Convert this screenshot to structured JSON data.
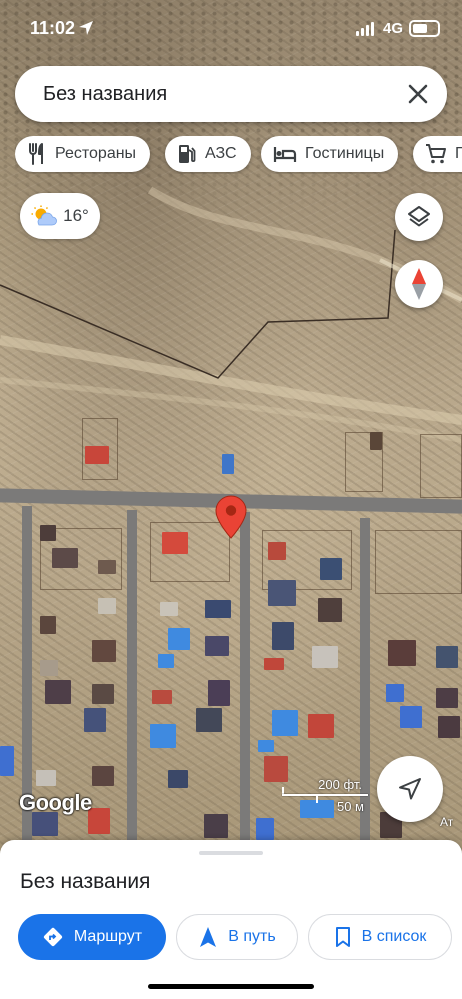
{
  "status_bar": {
    "time": "11:02",
    "network": "4G"
  },
  "search": {
    "query": "Без названия"
  },
  "chips": [
    {
      "label": "Рестораны",
      "icon": "restaurant-icon"
    },
    {
      "label": "АЗС",
      "icon": "gas-station-icon"
    },
    {
      "label": "Гостиницы",
      "icon": "hotel-icon"
    },
    {
      "label": "П",
      "icon": "shopping-cart-icon"
    }
  ],
  "weather": {
    "temperature": "16°",
    "icon": "partly-cloudy-icon"
  },
  "map": {
    "attribution": "Google",
    "scale_imperial": "200 фт.",
    "scale_metric": "50 м",
    "edge_label": "Ат"
  },
  "place_sheet": {
    "title": "Без названия",
    "directions_label": "Маршрут",
    "start_label": "В путь",
    "save_label": "В список"
  },
  "colors": {
    "accent": "#1a73e8",
    "pin": "#ea4335"
  }
}
